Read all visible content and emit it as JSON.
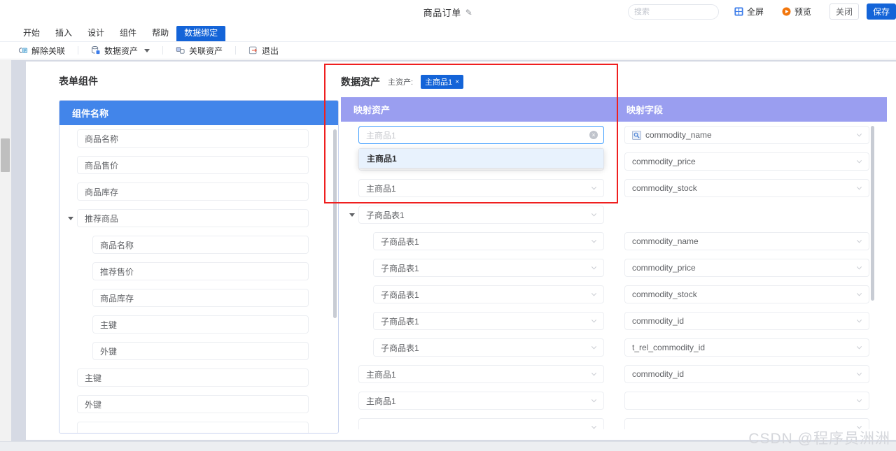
{
  "header": {
    "doc_title": "商品订单",
    "edit_icon": "pencil-icon",
    "search_placeholder": "搜索",
    "search_value": "",
    "fullscreen_label": "全屏",
    "preview_label": "预览",
    "close_label": "关闭",
    "save_label": "保存"
  },
  "menu": {
    "items": [
      {
        "label": "开始",
        "active": false
      },
      {
        "label": "插入",
        "active": false
      },
      {
        "label": "设计",
        "active": false
      },
      {
        "label": "组件",
        "active": false
      },
      {
        "label": "帮助",
        "active": false
      },
      {
        "label": "数据绑定",
        "active": true
      }
    ]
  },
  "toolbar": {
    "items": [
      {
        "label": "解除关联",
        "icon": "unlink-icon",
        "caret": false
      },
      {
        "label": "数据资产",
        "icon": "database-icon",
        "caret": true
      },
      {
        "label": "关联资产",
        "icon": "link-asset-icon",
        "caret": false
      },
      {
        "label": "退出",
        "icon": "exit-icon",
        "caret": false
      }
    ]
  },
  "left_panel": {
    "title": "表单组件",
    "column_header": "组件名称",
    "rows": [
      {
        "label": "商品名称",
        "level": 0,
        "twisty": false
      },
      {
        "label": "商品售价",
        "level": 0,
        "twisty": false
      },
      {
        "label": "商品库存",
        "level": 0,
        "twisty": false
      },
      {
        "label": "推荐商品",
        "level": 0,
        "twisty": true
      },
      {
        "label": "商品名称",
        "level": 1,
        "twisty": false
      },
      {
        "label": "推荐售价",
        "level": 1,
        "twisty": false
      },
      {
        "label": "商品库存",
        "level": 1,
        "twisty": false
      },
      {
        "label": "主键",
        "level": 1,
        "twisty": false
      },
      {
        "label": "外键",
        "level": 1,
        "twisty": false
      },
      {
        "label": "主键",
        "level": 0,
        "twisty": false
      },
      {
        "label": "外键",
        "level": 0,
        "twisty": false
      },
      {
        "label": "",
        "level": 0,
        "twisty": false
      }
    ]
  },
  "right_panel": {
    "title": "数据资产",
    "main_asset_label": "主资产:",
    "main_asset_tag": "主商品1",
    "tag_close": "×",
    "column_header_asset": "映射资产",
    "column_header_field": "映射字段",
    "rows": [
      {
        "asset": "主商品1",
        "field": "commodity_name",
        "level": 0,
        "twisty": false,
        "focused": true,
        "field_icon": "image-placeholder-icon"
      },
      {
        "asset": "主商品1",
        "field": "commodity_price",
        "level": 0,
        "twisty": false,
        "focused": false,
        "field_icon": ""
      },
      {
        "asset": "主商品1",
        "field": "commodity_stock",
        "level": 0,
        "twisty": false,
        "focused": false,
        "field_icon": ""
      },
      {
        "asset": "子商品表1",
        "field": "",
        "level": 0,
        "twisty": true,
        "focused": false,
        "field_icon": ""
      },
      {
        "asset": "子商品表1",
        "field": "commodity_name",
        "level": 1,
        "twisty": false,
        "focused": false,
        "field_icon": ""
      },
      {
        "asset": "子商品表1",
        "field": "commodity_price",
        "level": 1,
        "twisty": false,
        "focused": false,
        "field_icon": ""
      },
      {
        "asset": "子商品表1",
        "field": "commodity_stock",
        "level": 1,
        "twisty": false,
        "focused": false,
        "field_icon": ""
      },
      {
        "asset": "子商品表1",
        "field": "commodity_id",
        "level": 1,
        "twisty": false,
        "focused": false,
        "field_icon": ""
      },
      {
        "asset": "子商品表1",
        "field": "t_rel_commodity_id",
        "level": 1,
        "twisty": false,
        "focused": false,
        "field_icon": ""
      },
      {
        "asset": "主商品1",
        "field": "commodity_id",
        "level": 0,
        "twisty": false,
        "focused": false,
        "field_icon": ""
      },
      {
        "asset": "主商品1",
        "field": "",
        "level": 0,
        "twisty": false,
        "focused": false,
        "field_icon": ""
      },
      {
        "asset": "",
        "field": "",
        "level": 0,
        "twisty": false,
        "focused": false,
        "field_icon": ""
      }
    ],
    "dropdown": {
      "open": true,
      "input_placeholder": "主商品1",
      "input_value": "",
      "options": [
        "主商品1"
      ],
      "selected": "主商品1"
    }
  },
  "colors": {
    "primary_blue": "#1464d8",
    "header_blue": "#4285ea",
    "header_purple": "#9a9ef0",
    "highlight_red": "#ef1f1f",
    "canvas_gray": "#d6dae4"
  },
  "watermark": "CSDN @程序员洲洲"
}
